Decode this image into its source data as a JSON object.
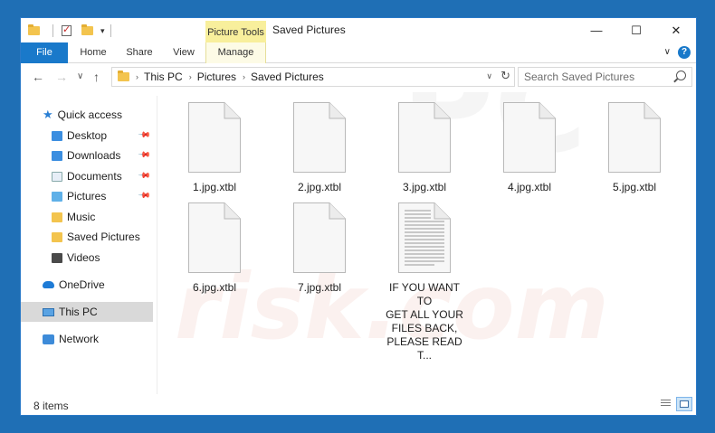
{
  "title_bar": {
    "contextual_tab": "Picture Tools",
    "window_title": "Saved Pictures",
    "minimize_glyph": "—",
    "maximize_glyph": "☐",
    "close_glyph": "✕",
    "quick_access_dropdown": "▾"
  },
  "ribbon": {
    "tabs": [
      {
        "label": "File"
      },
      {
        "label": "Home"
      },
      {
        "label": "Share"
      },
      {
        "label": "View"
      },
      {
        "label": "Manage"
      }
    ],
    "expand_glyph": "∨",
    "help_glyph": "?"
  },
  "nav": {
    "back_glyph": "←",
    "forward_glyph": "→",
    "recent_glyph": "∨",
    "up_glyph": "↑"
  },
  "address": {
    "crumbs": [
      "This PC",
      "Pictures",
      "Saved Pictures"
    ],
    "separator": "›",
    "dropdown_glyph": "∨",
    "refresh_glyph": "↻"
  },
  "search": {
    "placeholder": "Search Saved Pictures"
  },
  "sidebar": {
    "items": [
      {
        "label": "Quick access",
        "icon": "star-icon"
      },
      {
        "label": "Desktop",
        "icon": "desktop-icon",
        "pinned": true
      },
      {
        "label": "Downloads",
        "icon": "downloads-icon",
        "pinned": true
      },
      {
        "label": "Documents",
        "icon": "documents-icon",
        "pinned": true
      },
      {
        "label": "Pictures",
        "icon": "pictures-icon",
        "pinned": true
      },
      {
        "label": "Music",
        "icon": "music-icon"
      },
      {
        "label": "Saved Pictures",
        "icon": "folder-icon"
      },
      {
        "label": "Videos",
        "icon": "videos-icon"
      },
      {
        "label": "OneDrive",
        "icon": "cloud-icon"
      },
      {
        "label": "This PC",
        "icon": "computer-icon",
        "selected": true
      },
      {
        "label": "Network",
        "icon": "network-icon"
      }
    ],
    "pin_glyph": "📌"
  },
  "files": [
    {
      "name": "1.jpg.xtbl",
      "icon": "blank-file-icon"
    },
    {
      "name": "2.jpg.xtbl",
      "icon": "blank-file-icon"
    },
    {
      "name": "3.jpg.xtbl",
      "icon": "blank-file-icon"
    },
    {
      "name": "4.jpg.xtbl",
      "icon": "blank-file-icon"
    },
    {
      "name": "5.jpg.xtbl",
      "icon": "blank-file-icon"
    },
    {
      "name": "6.jpg.xtbl",
      "icon": "blank-file-icon"
    },
    {
      "name": "7.jpg.xtbl",
      "icon": "blank-file-icon"
    },
    {
      "name_lines": [
        "IF YOU WANT TO",
        "GET ALL YOUR",
        "FILES BACK,",
        "PLEASE READ T..."
      ],
      "icon": "text-file-icon"
    }
  ],
  "status": {
    "item_count": "8 items"
  },
  "watermark": "PC risk.com",
  "colors": {
    "desktop_bg": "#1f6fb5",
    "file_tab": "#1979ca",
    "picture_tools": "#f8ef9c",
    "selected_nav": "#d9d9d9"
  }
}
